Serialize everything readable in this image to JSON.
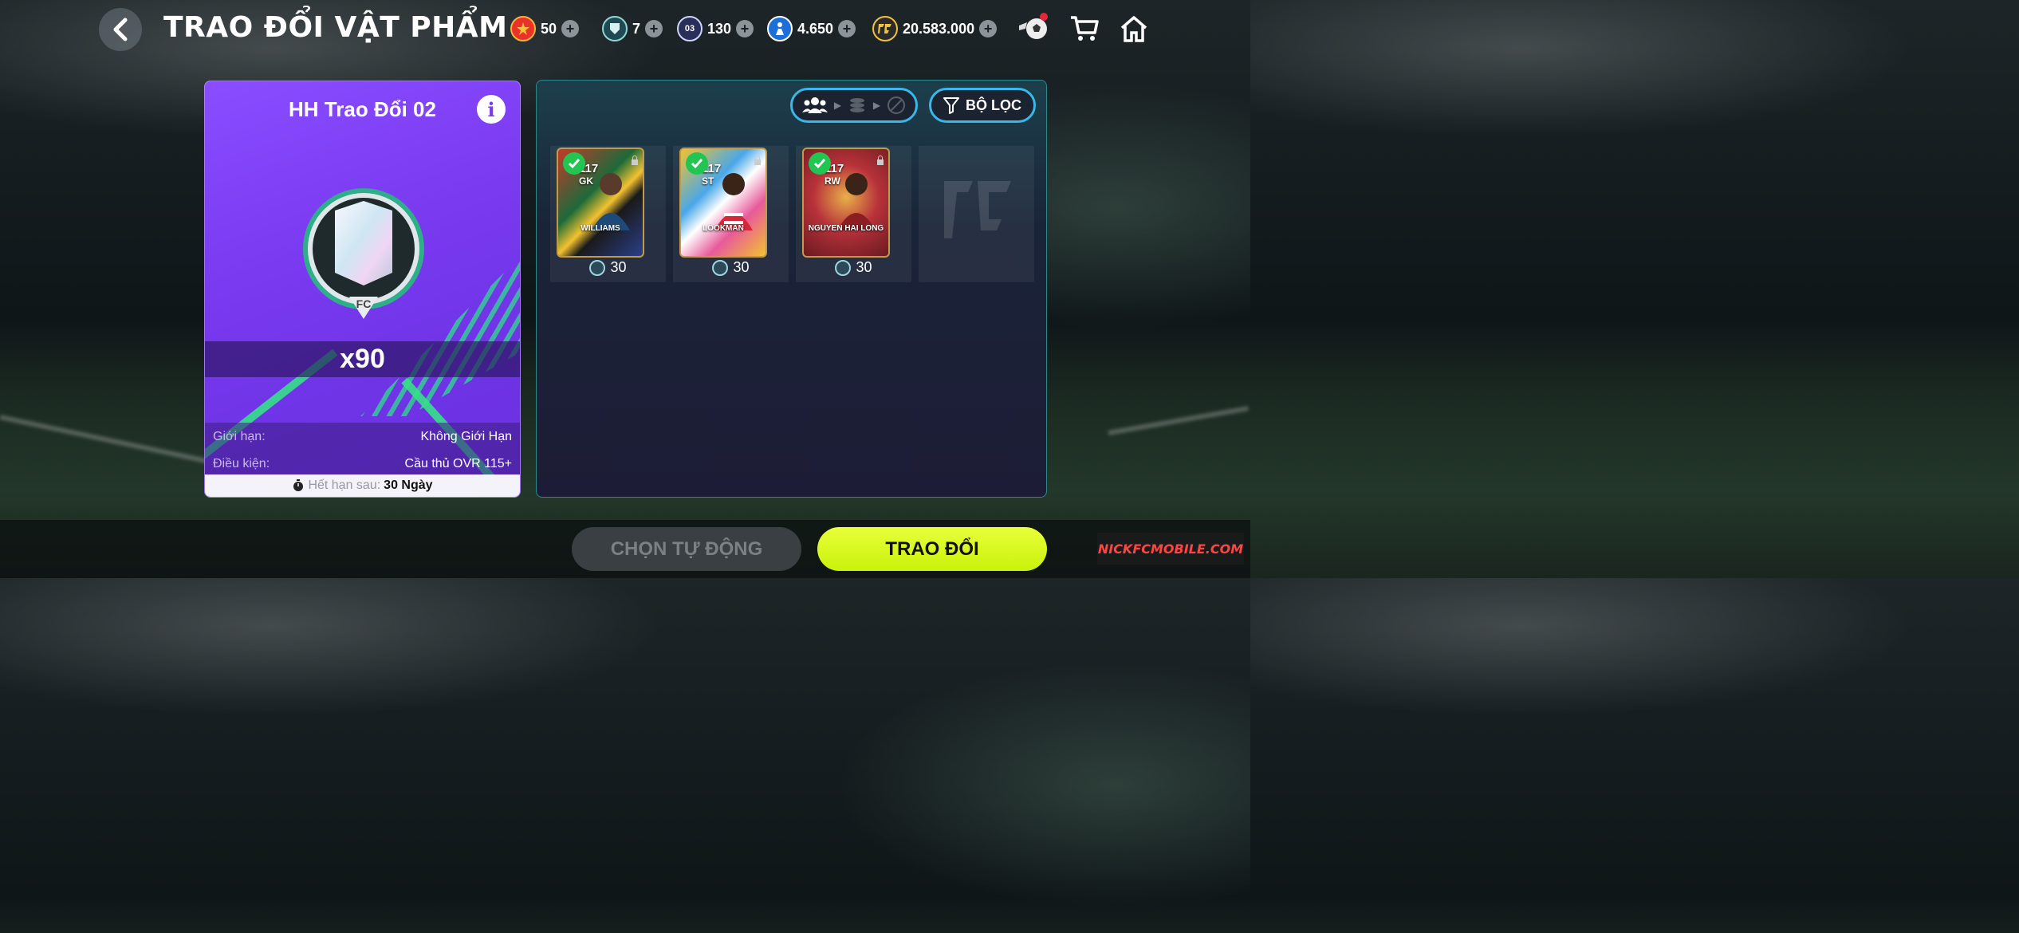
{
  "header": {
    "title": "TRAO ĐỔI VẬT PHẨM",
    "currencies": [
      {
        "value": "50",
        "icon": "star-token-icon",
        "label": ""
      },
      {
        "value": "7",
        "icon": "shield-token-icon",
        "label": ""
      },
      {
        "value": "130",
        "icon": "card-token-icon",
        "label": "03"
      },
      {
        "value": "4.650",
        "icon": "player-token-icon",
        "label": ""
      },
      {
        "value": "20.583.000",
        "icon": "fc-coin-icon",
        "label": ""
      }
    ]
  },
  "item_card": {
    "title": "HH Trao Đổi 02",
    "quantity": "x90",
    "limit_label": "Giới hạn:",
    "limit_value": "Không Giới Hạn",
    "condition_label": "Điều kiện:",
    "condition_value": "Cầu thủ OVR 115+",
    "expiry_label": "Hết hạn sau:",
    "expiry_value": "30 Ngày"
  },
  "panel": {
    "filter_label": "BỘ LỌC",
    "players": [
      {
        "ovr": "117",
        "position": "GK",
        "name": "WILLIAMS",
        "cost": "30",
        "selected": true
      },
      {
        "ovr": "117",
        "position": "ST",
        "name": "LOOKMAN",
        "cost": "30",
        "selected": true
      },
      {
        "ovr": "117",
        "position": "RW",
        "name": "NGUYEN HAI LONG",
        "cost": "30",
        "selected": true
      }
    ]
  },
  "actions": {
    "auto_select": "CHỌN TỰ ĐỘNG",
    "trade": "TRAO ĐỔI"
  },
  "watermark": "NICKFCMOBILE.COM",
  "colors": {
    "card_purple": "#7a3af0",
    "accent_cyan": "#38b7e8",
    "trade_yellow": "#d6f51e",
    "check_green": "#23c552"
  }
}
